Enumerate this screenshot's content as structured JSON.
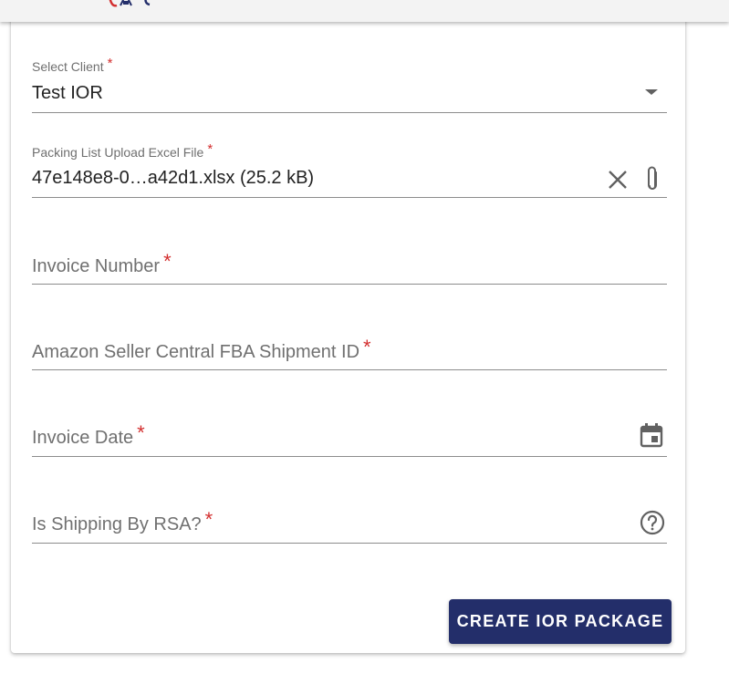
{
  "form": {
    "client": {
      "label": "Select Client",
      "required_mark": "*",
      "value": "Test IOR",
      "icon": "dropdown-arrow-icon"
    },
    "packing_list": {
      "label": "Packing List Upload Excel File",
      "required_mark": "*",
      "value": "47e148e8-0…a42d1.xlsx (25.2 kB)",
      "clear_icon": "close-icon",
      "attach_icon": "paperclip-icon"
    },
    "invoice_number": {
      "placeholder": "Invoice Number",
      "required_mark": "*"
    },
    "shipment_id": {
      "placeholder": "Amazon Seller Central FBA Shipment ID",
      "required_mark": "*"
    },
    "invoice_date": {
      "placeholder": "Invoice Date",
      "required_mark": "*",
      "icon": "calendar-icon"
    },
    "shipping_by_rsa": {
      "placeholder": "Is Shipping By RSA?",
      "required_mark": "*",
      "icon": "help-circle-icon"
    },
    "submit_label": "CREATE IOR PACKAGE"
  },
  "colors": {
    "primary": "#232e6a",
    "required": "#d32f2f",
    "underline": "#8c8c8c",
    "label": "#6f6f6f",
    "text": "#222222",
    "icon": "#616161",
    "logo_red": "#d32f2f",
    "logo_blue": "#232e6a"
  }
}
